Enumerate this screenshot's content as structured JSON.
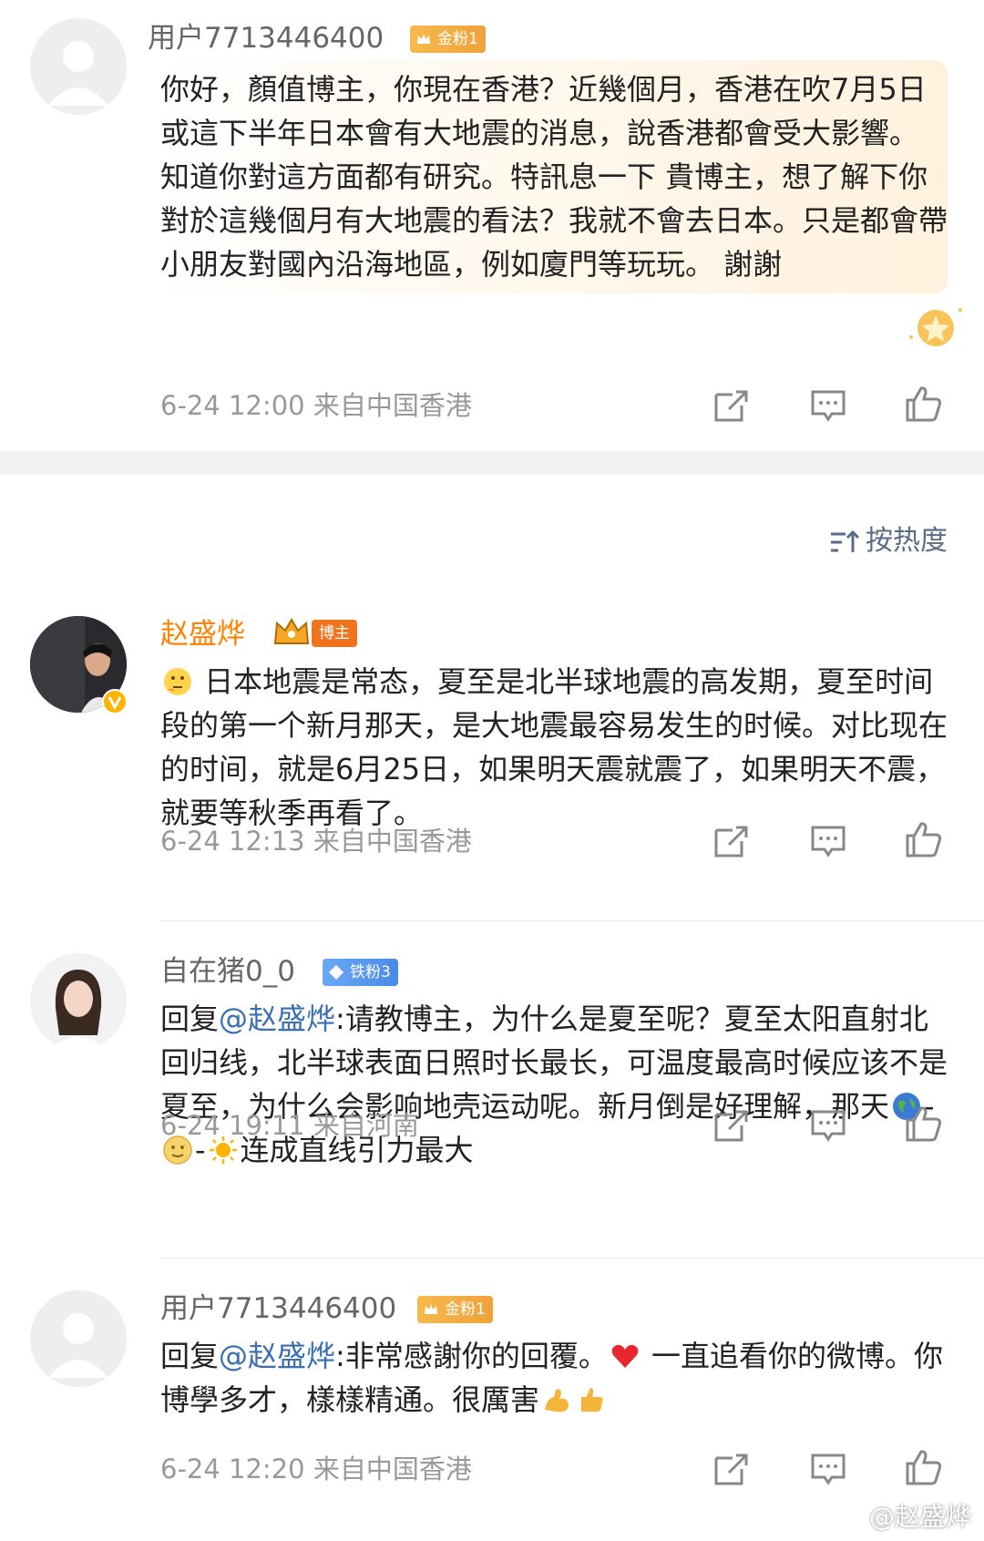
{
  "comments": [
    {
      "username": "用户7713446400",
      "badge": "金粉1",
      "text": "你好，顏值博主，你現在香港？近幾個月，香港在吹7月5日或這下半年日本會有大地震的消息，說香港都會受大影響。 知道你對這方面都有研究。特訊息一下 貴博主，想了解下你對於這幾個月有大地震的看法？我就不會去日本。只是都會帶小朋友對國內沿海地區，例如廈門等玩玩。 謝謝",
      "meta": "6-24 12:00 来自中国香港"
    },
    {
      "username": "赵盛烨",
      "badge": "博主",
      "text": "日本地震是常态，夏至是北半球地震的高发期，夏至时间段的第一个新月那天，是大地震最容易发生的时候。对比现在的时间，就是6月25日，如果明天震就震了，如果明天不震，就要等秋季再看了。",
      "meta": "6-24 12:13 来自中国香港"
    },
    {
      "username": "自在猪0_0",
      "badge": "铁粉3",
      "reply_prefix": "回复",
      "mention": "@赵盛烨",
      "text_a": ":请教博主，为什么是夏至呢？夏至太阳直射北回归线，北半球表面日照时长最长，可温度最高时候应该不是夏至，为什么会影响地壳运动呢。新月倒是好理解，那天",
      "sep1": "-",
      "sep2": "-",
      "text_b": "连成直线引力最大",
      "meta": "6-24 19:11 来自河南"
    },
    {
      "username": "用户7713446400",
      "badge": "金粉1",
      "reply_prefix": "回复",
      "mention": "@赵盛烨",
      "text_a": ":非常感謝你的回覆。",
      "text_b": " 一直追看你的微博。你博學多才，樣樣精通。很厲害",
      "meta": "6-24 12:20 来自中国香港"
    }
  ],
  "sort_label": "按热度",
  "watermark": "@赵盛烨",
  "icons": [
    "repost-icon",
    "comment-icon",
    "like-icon"
  ],
  "colors": {
    "host_name": "#ff8200",
    "mention": "#3b6fb3",
    "meta": "#999999"
  }
}
